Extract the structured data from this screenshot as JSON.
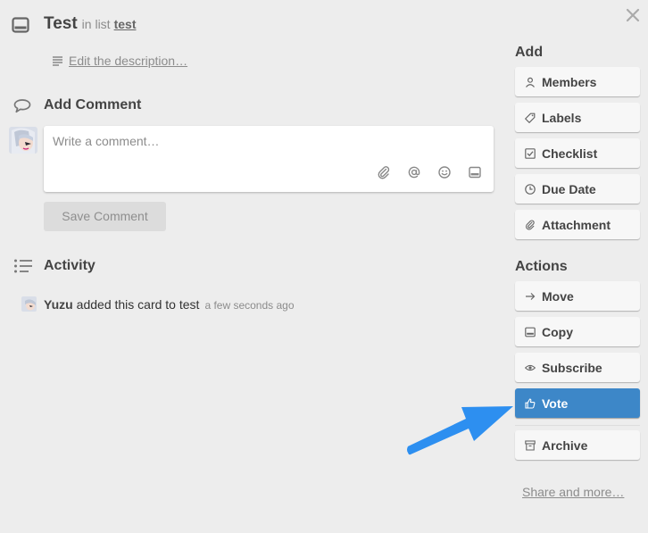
{
  "card": {
    "title": "Test",
    "in_list_prefix": "in list",
    "list_name": "test",
    "edit_description": "Edit the description…"
  },
  "comment": {
    "heading": "Add Comment",
    "placeholder": "Write a comment…",
    "save_label": "Save Comment"
  },
  "activity": {
    "heading": "Activity",
    "user": "Yuzu",
    "action": "added this card to test",
    "time": "a few seconds ago"
  },
  "sidebar": {
    "add_heading": "Add",
    "add_buttons": [
      {
        "label": "Members",
        "icon": "person-icon"
      },
      {
        "label": "Labels",
        "icon": "tag-icon"
      },
      {
        "label": "Checklist",
        "icon": "checkbox-icon"
      },
      {
        "label": "Due Date",
        "icon": "clock-icon"
      },
      {
        "label": "Attachment",
        "icon": "paperclip-icon"
      }
    ],
    "actions_heading": "Actions",
    "action_buttons": [
      {
        "label": "Move",
        "icon": "arrow-right-icon"
      },
      {
        "label": "Copy",
        "icon": "card-icon"
      },
      {
        "label": "Subscribe",
        "icon": "eye-icon"
      },
      {
        "label": "Vote",
        "icon": "thumbs-up-icon",
        "active": true
      },
      {
        "label": "Archive",
        "icon": "archive-box-icon"
      }
    ],
    "share_label": "Share and more…"
  },
  "colors": {
    "background": "#ededed",
    "vote_active": "#3d87c8",
    "pointer_arrow": "#2d8ff0"
  }
}
